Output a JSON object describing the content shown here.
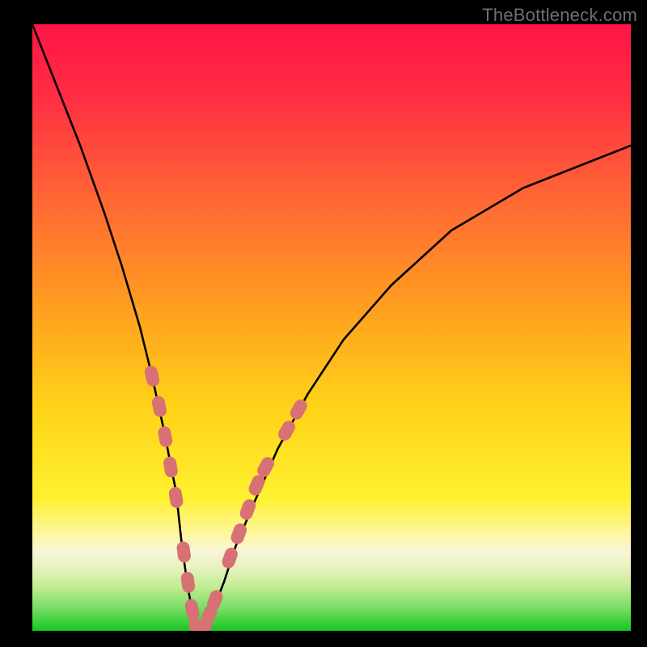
{
  "watermark": "TheBottleneck.com",
  "colors": {
    "black": "#000000",
    "curve": "#000000",
    "marker_fill": "#d87176",
    "marker_stroke": "#d87176",
    "gradient_stops": [
      {
        "offset": "0%",
        "color": "#ff1445"
      },
      {
        "offset": "12%",
        "color": "#ff2e44"
      },
      {
        "offset": "30%",
        "color": "#ff6a33"
      },
      {
        "offset": "48%",
        "color": "#ffa31f"
      },
      {
        "offset": "63%",
        "color": "#ffd218"
      },
      {
        "offset": "78%",
        "color": "#fff12e"
      },
      {
        "offset": "84%",
        "color": "#fdf6a0"
      },
      {
        "offset": "87%",
        "color": "#f7f6d8"
      },
      {
        "offset": "90%",
        "color": "#e4f2b9"
      },
      {
        "offset": "93%",
        "color": "#bdeb8f"
      },
      {
        "offset": "96%",
        "color": "#7ddf68"
      },
      {
        "offset": "100%",
        "color": "#17c823"
      }
    ]
  },
  "chart_data": {
    "type": "line",
    "title": "",
    "xlabel": "",
    "ylabel": "",
    "xlim": [
      0,
      100
    ],
    "ylim": [
      0,
      100
    ],
    "series": [
      {
        "name": "bottleneck-curve",
        "x": [
          0,
          4,
          8,
          12,
          15,
          18,
          20,
          22,
          24,
          25,
          26,
          27,
          27.5,
          28.5,
          30,
          32,
          34,
          37,
          41,
          46,
          52,
          60,
          70,
          82,
          100
        ],
        "y": [
          100,
          90,
          80,
          69,
          60,
          50,
          42,
          33,
          23,
          14,
          7,
          2,
          0,
          0,
          3,
          8,
          14,
          21,
          30,
          39,
          48,
          57,
          66,
          73,
          80
        ]
      }
    ],
    "markers": {
      "name": "highlight-points",
      "points": [
        {
          "x": 20.0,
          "y": 42.0
        },
        {
          "x": 21.2,
          "y": 37.0
        },
        {
          "x": 22.2,
          "y": 32.0
        },
        {
          "x": 23.1,
          "y": 27.0
        },
        {
          "x": 24.0,
          "y": 22.0
        },
        {
          "x": 25.3,
          "y": 13.0
        },
        {
          "x": 26.0,
          "y": 8.0
        },
        {
          "x": 26.7,
          "y": 3.5
        },
        {
          "x": 27.5,
          "y": 0.5
        },
        {
          "x": 28.5,
          "y": 0.5
        },
        {
          "x": 29.5,
          "y": 2.5
        },
        {
          "x": 30.5,
          "y": 5.0
        },
        {
          "x": 33.0,
          "y": 12.0
        },
        {
          "x": 34.5,
          "y": 16.0
        },
        {
          "x": 36.0,
          "y": 20.0
        },
        {
          "x": 37.5,
          "y": 24.0
        },
        {
          "x": 39.0,
          "y": 27.0
        },
        {
          "x": 42.5,
          "y": 33.0
        },
        {
          "x": 44.5,
          "y": 36.5
        }
      ]
    }
  }
}
